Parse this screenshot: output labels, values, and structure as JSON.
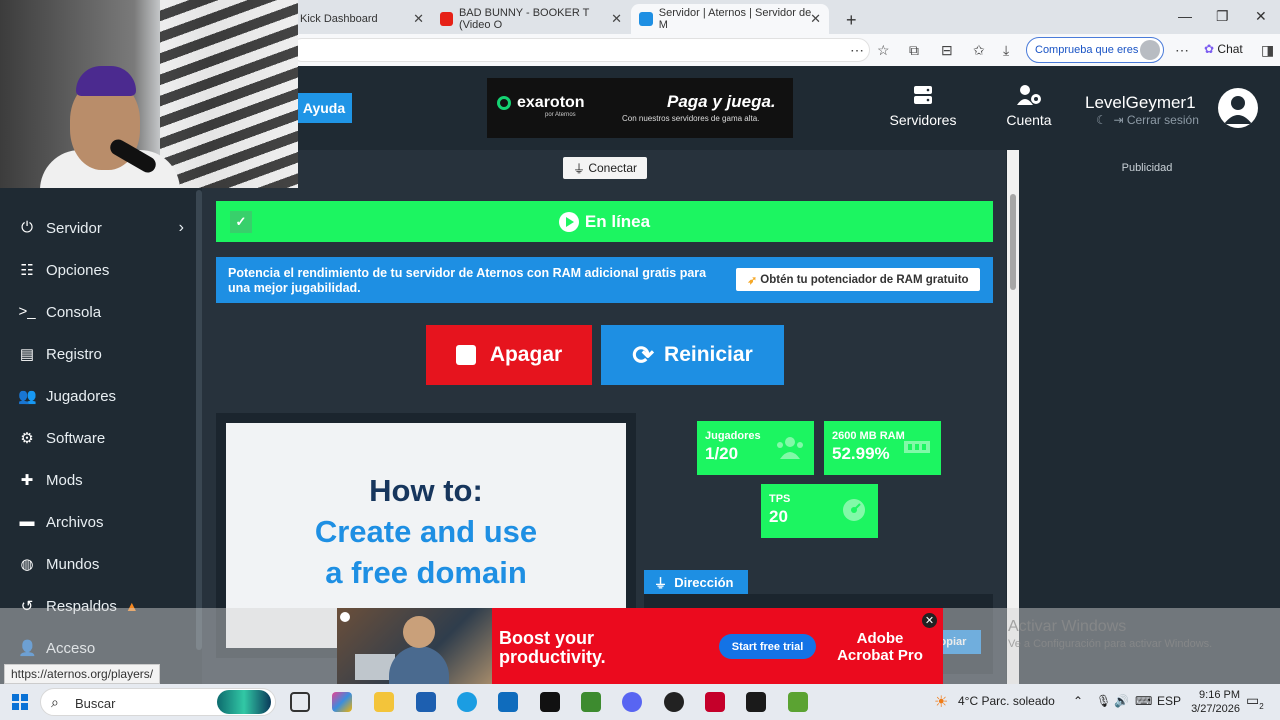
{
  "browser": {
    "tabs": [
      {
        "title": "Kick Dashboard"
      },
      {
        "title": "BAD BUNNY - BOOKER T (Video O"
      },
      {
        "title": "Servidor | Aternos | Servidor de M"
      }
    ],
    "new_tab_glyph": "+",
    "verify_label": "Comprueba que eres tú",
    "chat_label": "Chat",
    "status_url": "https://aternos.org/players/"
  },
  "header": {
    "help_label": "Ayuda",
    "banner": {
      "logo_text": "exaroton",
      "logo_sub": "por Aternos",
      "headline": "Paga y juega.",
      "subline": "Con nuestros servidores de gama alta."
    },
    "nav": [
      {
        "label": "Servidores",
        "icon": "servers-icon"
      },
      {
        "label": "Cuenta",
        "icon": "account-settings-icon"
      }
    ],
    "user": {
      "name": "LevelGeymer1",
      "logout_label": "Cerrar sesión"
    }
  },
  "sidebar": {
    "items": [
      {
        "label": "Servidor",
        "icon": "power-icon"
      },
      {
        "label": "Opciones",
        "icon": "options-icon"
      },
      {
        "label": "Consola",
        "icon": "console-icon"
      },
      {
        "label": "Registro",
        "icon": "log-icon"
      },
      {
        "label": "Jugadores",
        "icon": "players-icon"
      },
      {
        "label": "Software",
        "icon": "gears-icon"
      },
      {
        "label": "Mods",
        "icon": "puzzle-icon"
      },
      {
        "label": "Archivos",
        "icon": "folder-icon"
      },
      {
        "label": "Mundos",
        "icon": "globe-icon"
      },
      {
        "label": "Respaldos",
        "icon": "backup-icon"
      },
      {
        "label": "Acceso",
        "icon": "user-lock-icon"
      }
    ]
  },
  "main": {
    "connect_label": "Conectar",
    "status_label": "En línea",
    "ram_promo": {
      "text": "Potencia el rendimiento de tu servidor de Aternos con RAM adicional gratis para una mejor jugabilidad.",
      "cta": "Obtén tu potenciador de RAM gratuito"
    },
    "stop_label": "Apagar",
    "restart_label": "Reiniciar",
    "video": {
      "line1": "How to:",
      "line2": "Create and use",
      "line3": "a free domain"
    },
    "stats": {
      "players": {
        "label": "Jugadores",
        "value": "1/20"
      },
      "ram": {
        "label": "2600 MB RAM",
        "value": "52.99%"
      },
      "tps": {
        "label": "TPS",
        "value": "20"
      }
    },
    "address_label": "Dirección",
    "copy_label": "opiar"
  },
  "right_column": {
    "ad_label": "Publicidad"
  },
  "ad_bottom": {
    "headline_1": "Boost your",
    "headline_2": "productivity.",
    "cta": "Start free trial",
    "brand_1": "Adobe",
    "brand_2": "Acrobat Pro"
  },
  "windows_watermark": {
    "title": "Activar Windows",
    "sub": "Ve a Configuración para activar Windows."
  },
  "taskbar": {
    "search_label": "Buscar",
    "weather": "4°C  Parc. soleado",
    "lang": "ESP",
    "time": "9:16 PM",
    "date": "3/27/2026",
    "notif_count": "2"
  }
}
